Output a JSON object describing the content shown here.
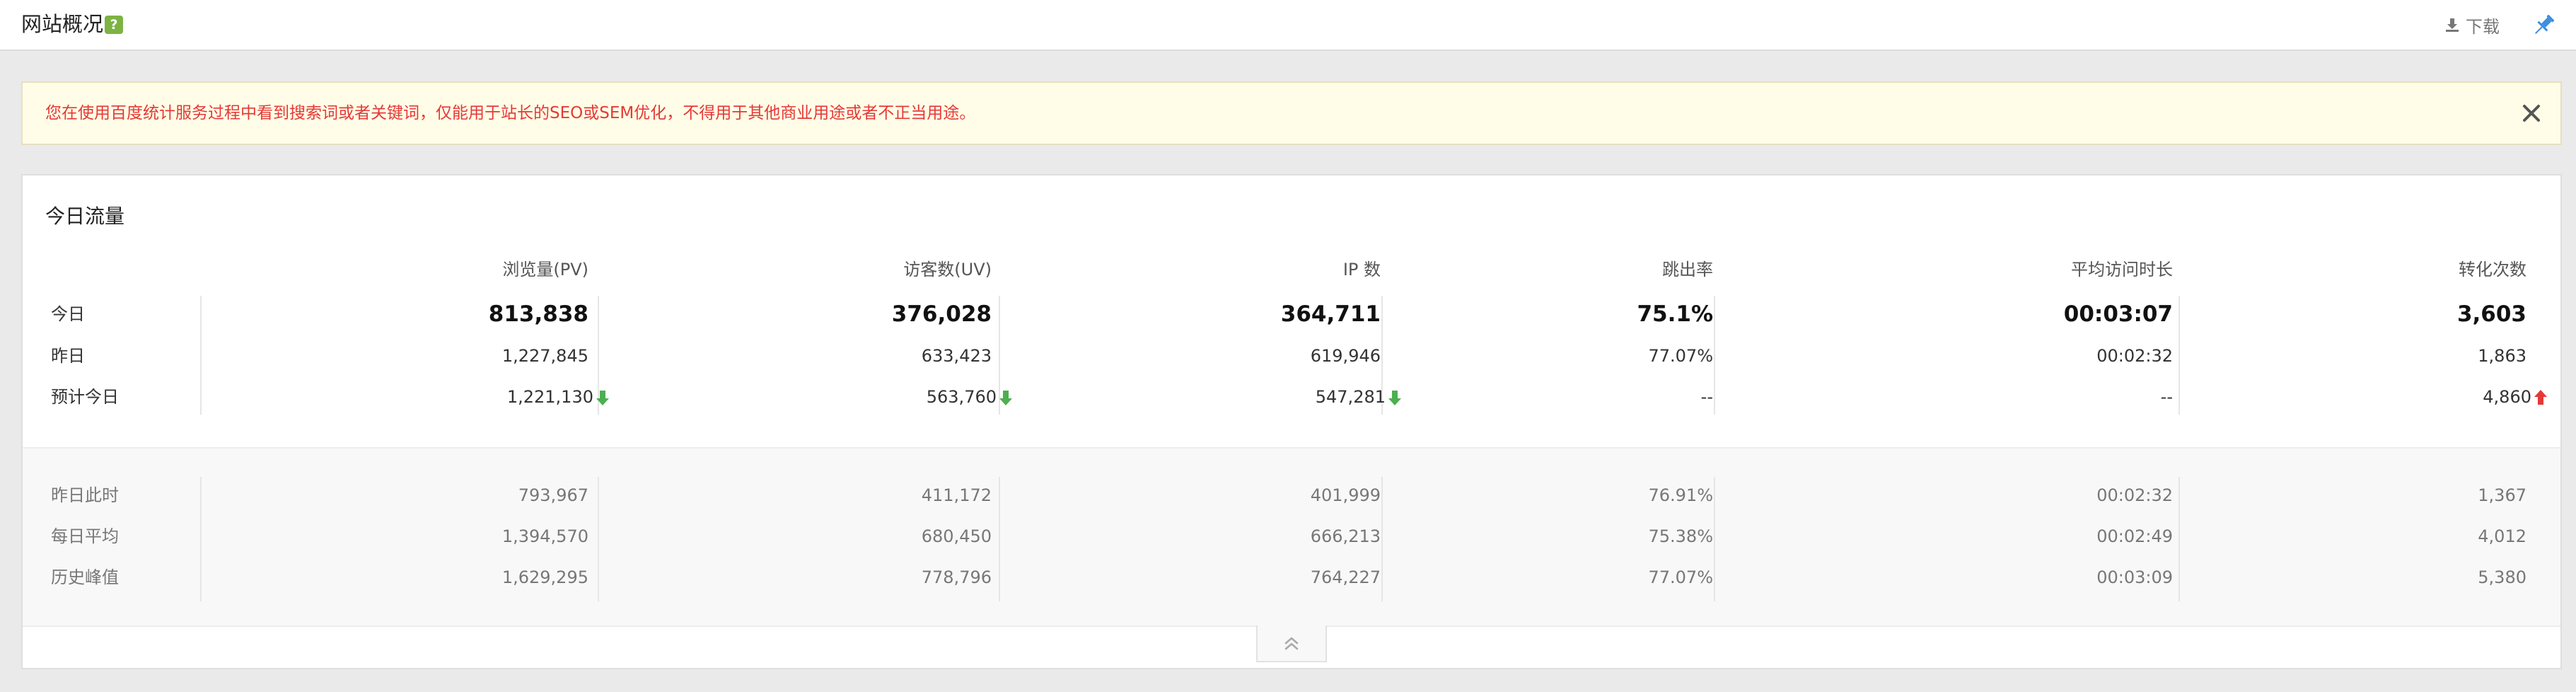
{
  "header": {
    "title": "网站概况",
    "help_icon": "?",
    "download_label": "下载"
  },
  "alert": {
    "text": "您在使用百度统计服务过程中看到搜索词或者关键词，仅能用于站长的SEO或SEM优化，不得用于其他商业用途或者不正当用途。"
  },
  "panel": {
    "title": "今日流量",
    "columns": [
      "浏览量(PV)",
      "访客数(UV)",
      "IP 数",
      "跳出率",
      "平均访问时长",
      "转化次数"
    ],
    "rows": [
      {
        "label": "今日",
        "values": [
          "813,838",
          "376,028",
          "364,711",
          "75.1%",
          "00:03:07",
          "3,603"
        ]
      },
      {
        "label": "昨日",
        "values": [
          "1,227,845",
          "633,423",
          "619,946",
          "77.07%",
          "00:02:32",
          "1,863"
        ]
      },
      {
        "label": "预计今日",
        "values": [
          "1,221,130",
          "563,760",
          "547,281",
          "--",
          "--",
          "4,860"
        ]
      }
    ],
    "forecast_trends": [
      "down",
      "down",
      "down",
      "",
      "",
      "up"
    ],
    "history_rows": [
      {
        "label": "昨日此时",
        "values": [
          "793,967",
          "411,172",
          "401,999",
          "76.91%",
          "00:02:32",
          "1,367"
        ]
      },
      {
        "label": "每日平均",
        "values": [
          "1,394,570",
          "680,450",
          "666,213",
          "75.38%",
          "00:02:49",
          "4,012"
        ]
      },
      {
        "label": "历史峰值",
        "values": [
          "1,629,295",
          "778,796",
          "764,227",
          "77.07%",
          "00:03:09",
          "5,380"
        ]
      }
    ]
  },
  "colors": {
    "alert_text": "#e53935",
    "trend_down": "#4caf50",
    "trend_up": "#e53935",
    "help_badge": "#7cb342",
    "pin": "#3d8fe0"
  }
}
